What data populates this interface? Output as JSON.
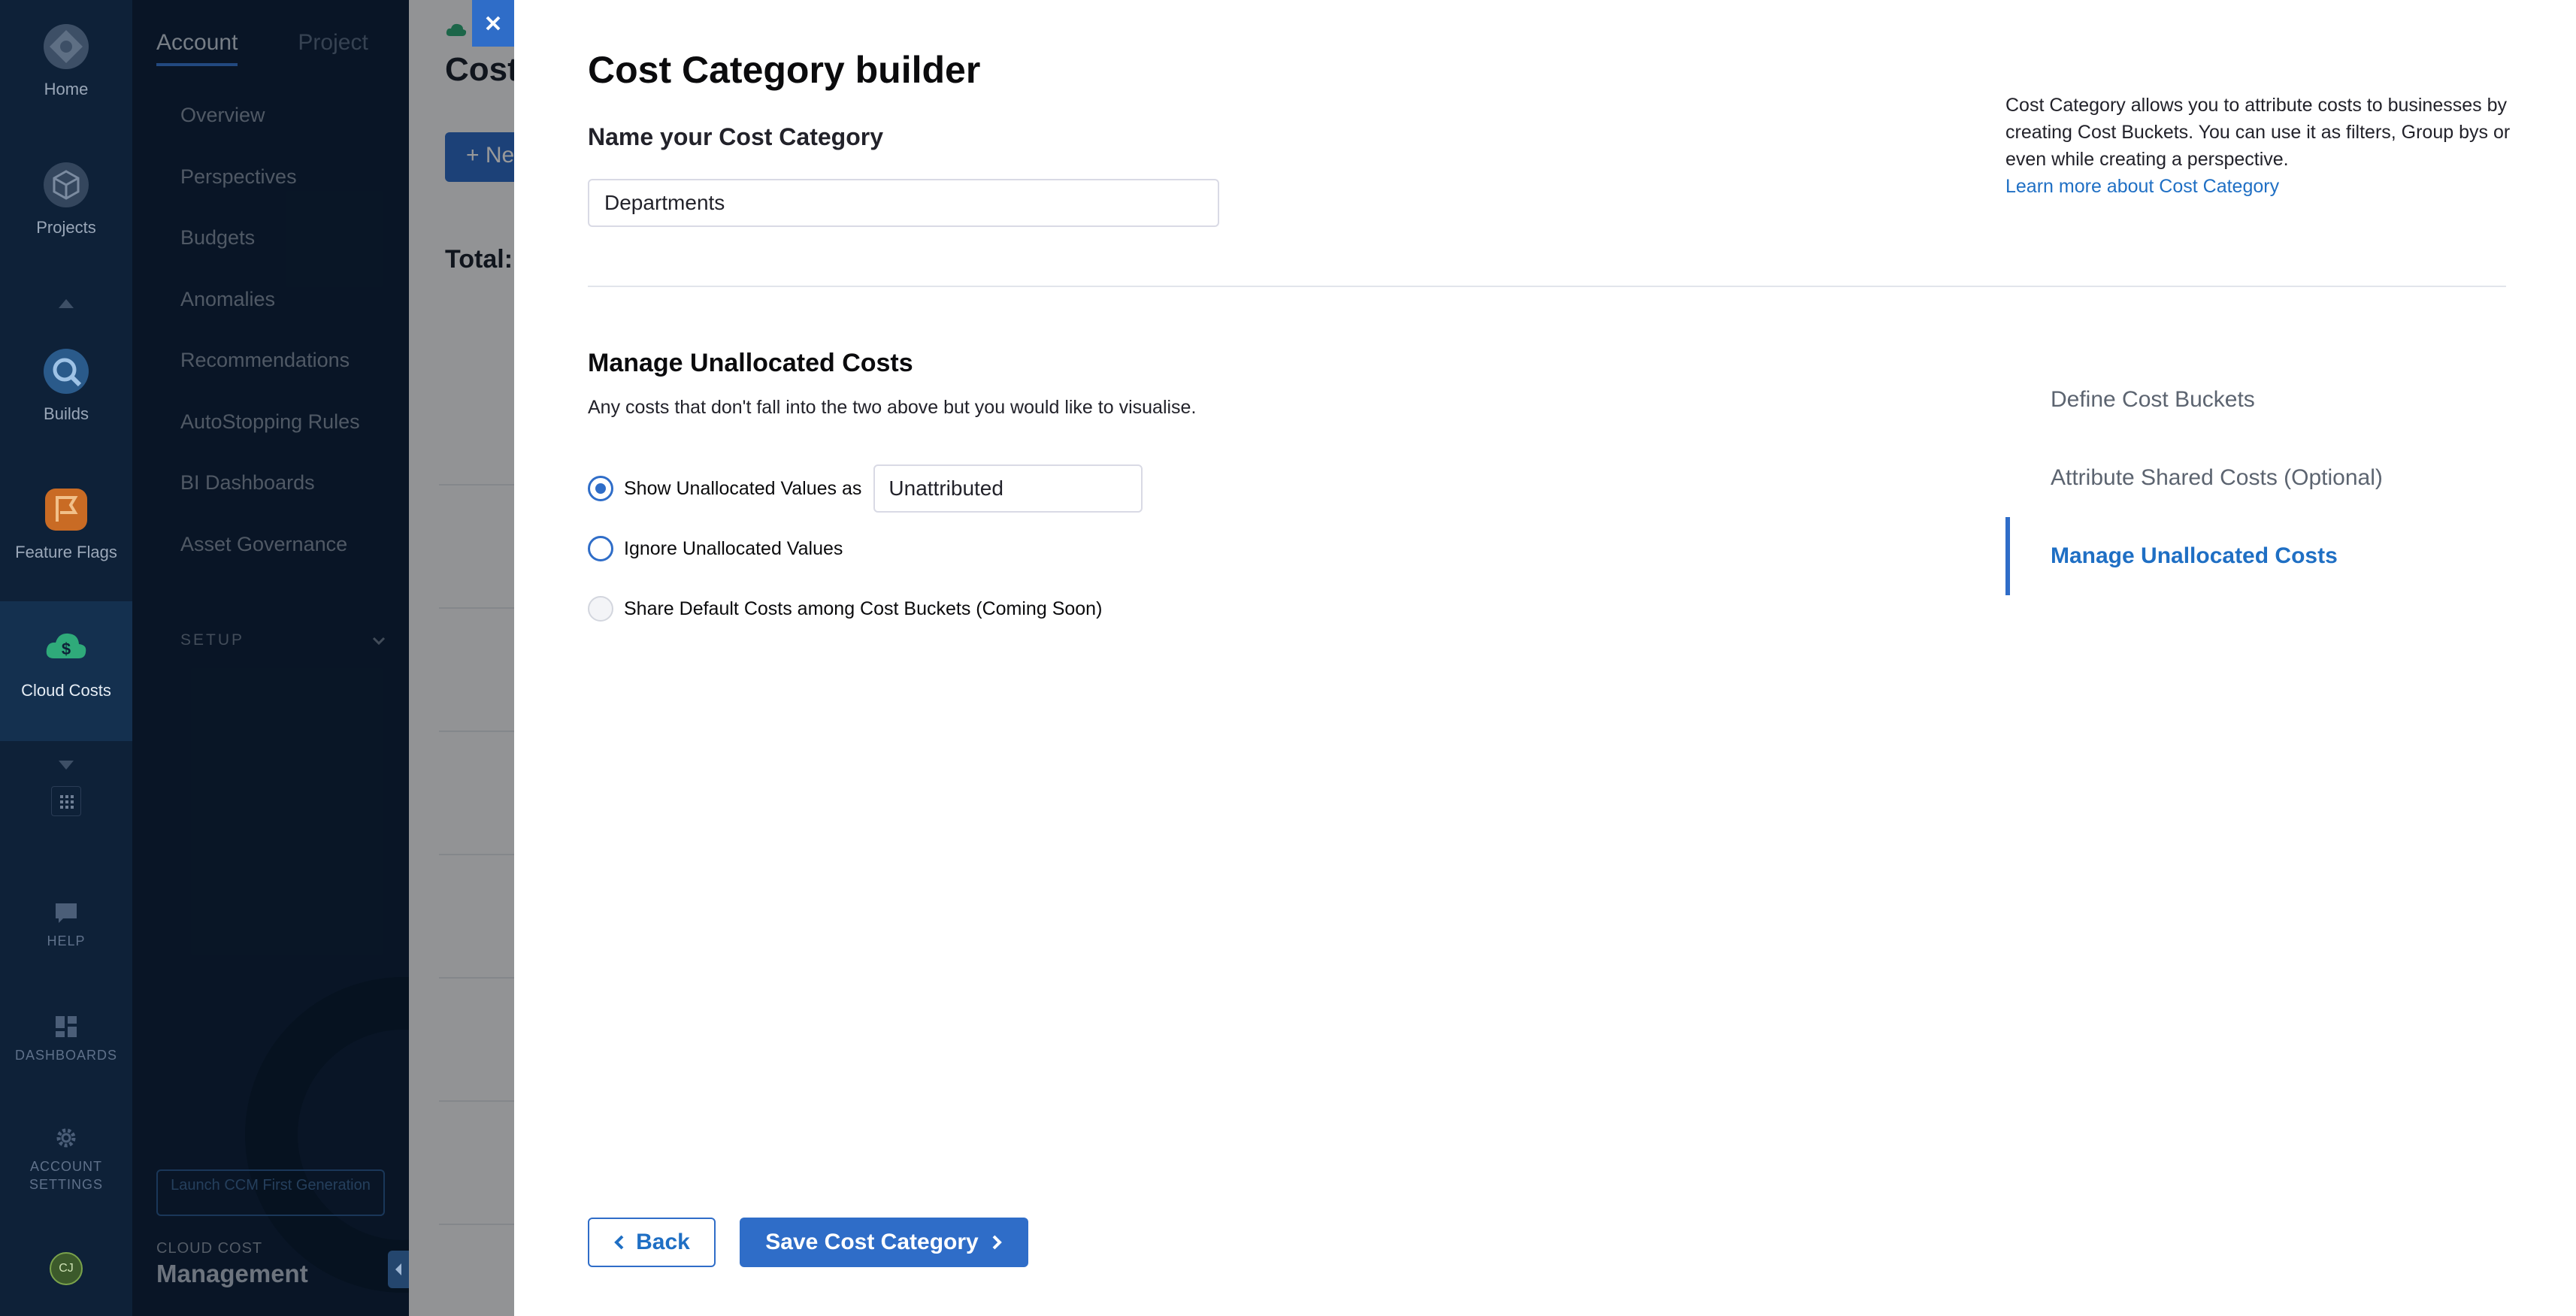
{
  "nav_rail": {
    "items": [
      {
        "label": "Home",
        "icon": "harness-logo-icon"
      },
      {
        "label": "Projects",
        "icon": "cube-icon"
      },
      {
        "label": "Builds",
        "icon": "builds-icon"
      },
      {
        "label": "Feature Flags",
        "icon": "flag-icon"
      },
      {
        "label": "Cloud Costs",
        "icon": "cloud-dollar-icon"
      }
    ],
    "help_label": "HELP",
    "dashboards_label": "DASHBOARDS",
    "account_settings_label": "ACCOUNT SETTINGS",
    "avatar_initials": "CJ"
  },
  "side_panel": {
    "tabs": [
      "Account",
      "Project"
    ],
    "active_tab": "Account",
    "items": [
      "Overview",
      "Perspectives",
      "Budgets",
      "Anomalies",
      "Recommendations",
      "AutoStopping Rules",
      "BI Dashboards",
      "Asset Governance"
    ],
    "setup_label": "SETUP",
    "launch_button": "Launch CCM First Generation",
    "brand_small": "CLOUD COST",
    "brand_big": "Management"
  },
  "background_page": {
    "title": "Cost",
    "new_button": "+ Ne",
    "total_label": "Total:"
  },
  "builder": {
    "title": "Cost Category builder",
    "name_label": "Name your Cost Category",
    "name_value": "Departments",
    "info_text": "Cost Category allows you to attribute costs to businesses by creating Cost Buckets. You can use it as filters, Group bys or even while creating a perspective.",
    "learn_more": "Learn more about Cost Category",
    "section_title": "Manage Unallocated Costs",
    "section_desc": "Any costs that don't fall into the two above but you would like to visualise.",
    "options": [
      {
        "label": "Show Unallocated Values as",
        "checked": true,
        "disabled": false
      },
      {
        "label": "Ignore Unallocated Values",
        "checked": false,
        "disabled": false
      },
      {
        "label": "Share Default Costs among Cost Buckets (Coming Soon)",
        "checked": false,
        "disabled": true
      }
    ],
    "unallocated_value": "Unattributed",
    "steps": [
      "Define Cost Buckets",
      "Attribute Shared Costs (Optional)",
      "Manage Unallocated Costs"
    ],
    "active_step": "Manage Unallocated Costs",
    "back_button": "Back",
    "save_button": "Save Cost Category"
  },
  "colors": {
    "accent": "#2f6dc8",
    "link": "#1f6fc4",
    "nav_bg": "#0e2138",
    "panel_bg": "#0f2440"
  }
}
